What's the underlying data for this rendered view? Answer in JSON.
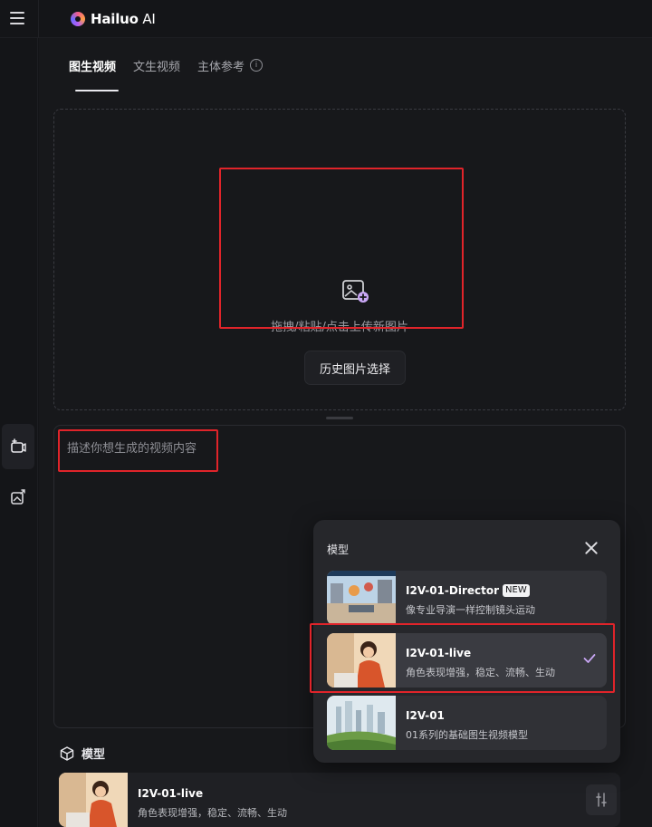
{
  "app": {
    "logo_word": "Hailuo",
    "logo_suffix": " AI"
  },
  "tabs": [
    {
      "label": "图生视频",
      "active": true
    },
    {
      "label": "文生视频",
      "active": false
    },
    {
      "label": "主体参考",
      "active": false
    }
  ],
  "upload": {
    "hint": "拖拽/粘贴/点击上传新图片",
    "history_button": "历史图片选择"
  },
  "prompt": {
    "placeholder": "描述你想生成的视频内容"
  },
  "model_section": {
    "label": "模型",
    "selected": {
      "name": "I2V-01-live",
      "desc": "角色表现增强，稳定、流畅、生动"
    }
  },
  "model_popover": {
    "title": "模型",
    "options": [
      {
        "name": "I2V-01-Director",
        "badge": "NEW",
        "desc": "像专业导演一样控制镜头运动",
        "selected": false
      },
      {
        "name": "I2V-01-live",
        "badge": "",
        "desc": "角色表现增强，稳定、流畅、生动",
        "selected": true
      },
      {
        "name": "I2V-01",
        "badge": "",
        "desc": "01系列的基础图生视频模型",
        "selected": false
      }
    ]
  },
  "icons": {
    "menu": "hamburger-icon",
    "video_tool": "video-create-icon",
    "image_tool": "image-swap-icon",
    "upload": "image-add-icon",
    "info": "info-icon",
    "model": "cube-icon",
    "settings": "sliders-icon",
    "close": "close-icon",
    "check": "check-icon"
  },
  "colors": {
    "background": "#141518",
    "panel": "#17181b",
    "highlight_box": "#e0242a",
    "accent_check": "#c9a7f5"
  }
}
